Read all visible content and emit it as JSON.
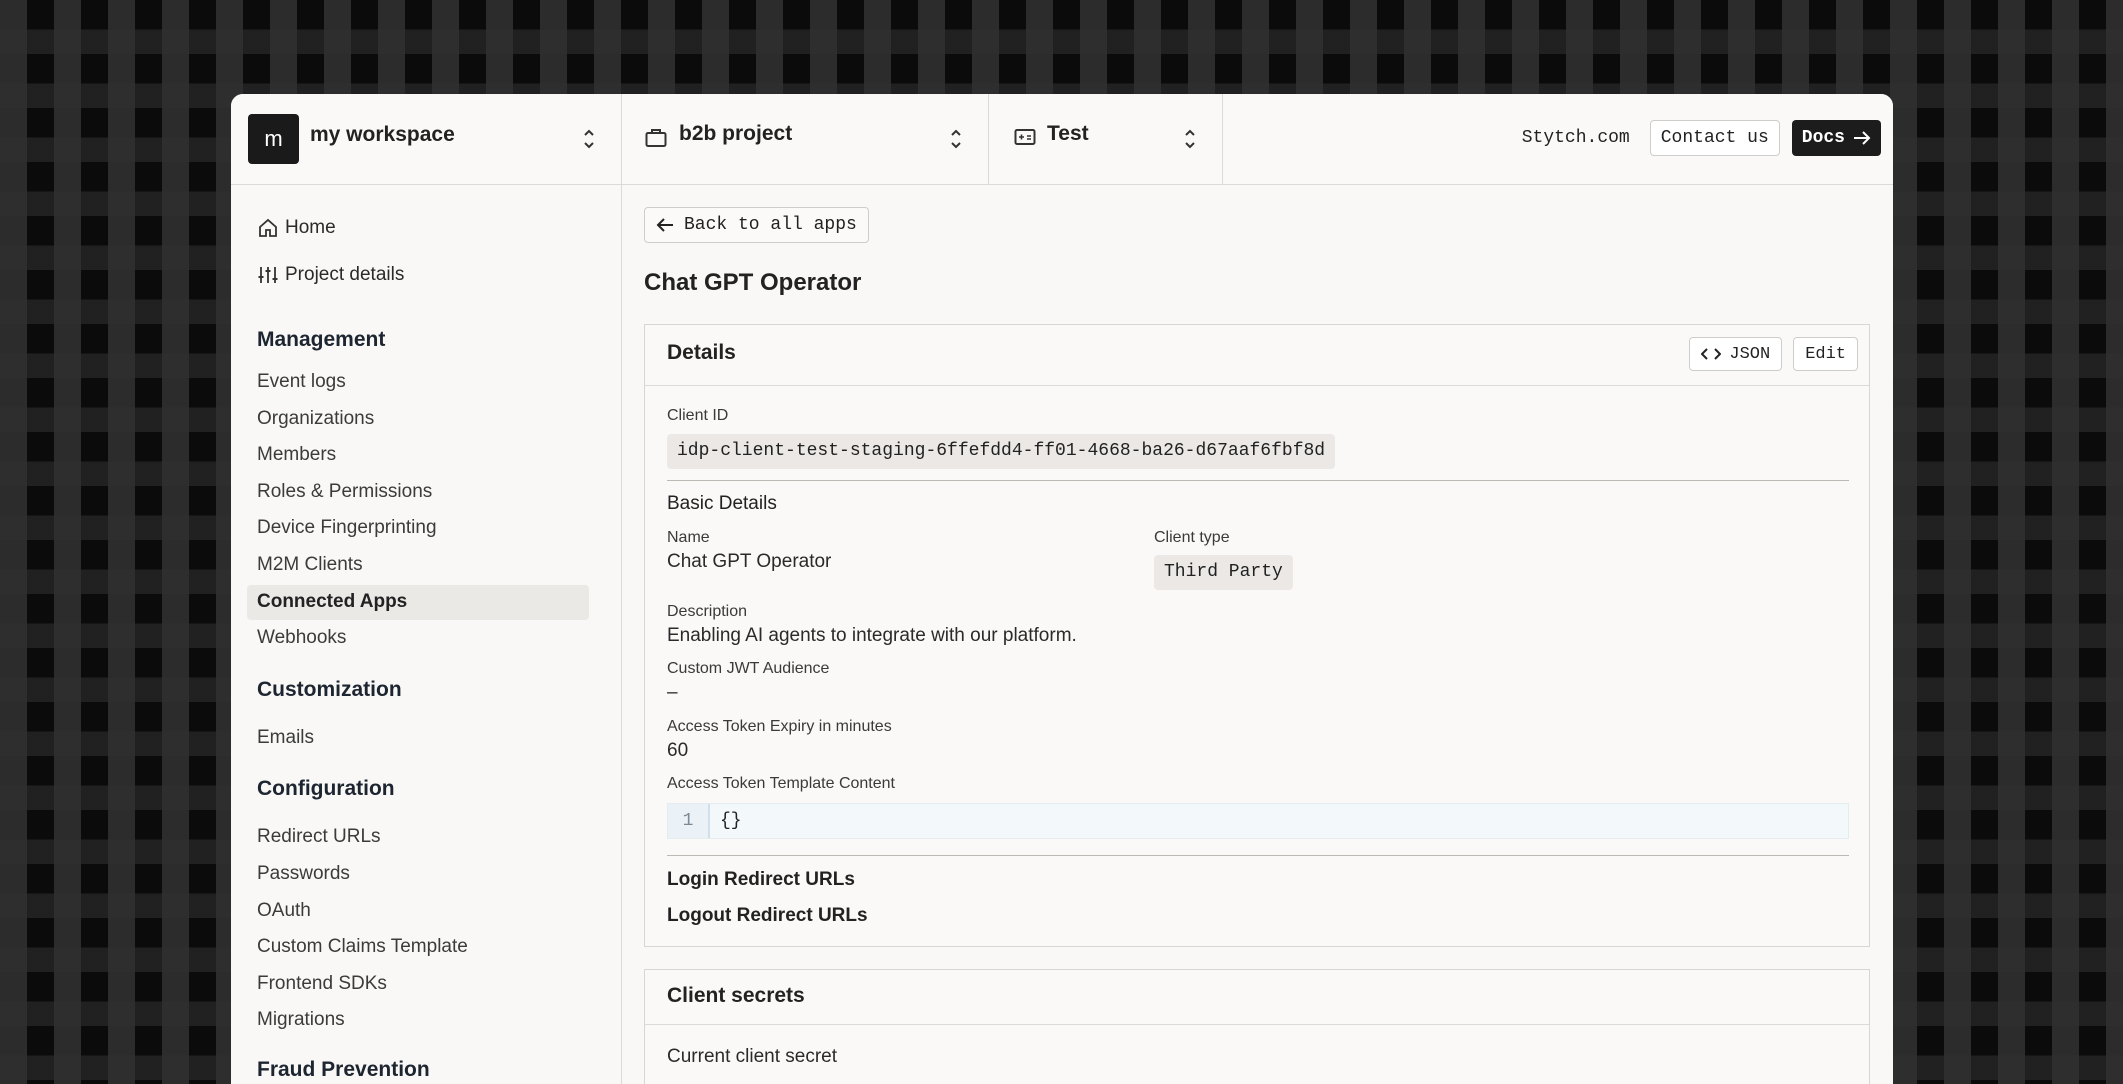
{
  "workspace": {
    "avatar_letter": "m",
    "name": "my workspace"
  },
  "project": {
    "name": "b2b project"
  },
  "environment": {
    "name": "Test"
  },
  "header_links": {
    "site": "Stytch.com",
    "contact": "Contact us",
    "docs": "Docs"
  },
  "sidebar": {
    "top": [
      {
        "label": "Home",
        "icon": "home-icon"
      },
      {
        "label": "Project details",
        "icon": "sliders-icon"
      }
    ],
    "sections": [
      {
        "title": "Management",
        "items": [
          "Event logs",
          "Organizations",
          "Members",
          "Roles & Permissions",
          "Device Fingerprinting",
          "M2M Clients",
          "Connected Apps",
          "Webhooks"
        ],
        "active": "Connected Apps"
      },
      {
        "title": "Customization",
        "items": [
          "Emails"
        ]
      },
      {
        "title": "Configuration",
        "items": [
          "Redirect URLs",
          "Passwords",
          "OAuth",
          "Custom Claims Template",
          "Frontend SDKs",
          "Migrations"
        ]
      },
      {
        "title": "Fraud Prevention",
        "items": []
      }
    ]
  },
  "main": {
    "back_label": "Back to all apps",
    "title": "Chat GPT Operator",
    "details": {
      "title": "Details",
      "json_label": "JSON",
      "edit_label": "Edit",
      "client_id_label": "Client ID",
      "client_id": "idp-client-test-staging-6ffefdd4-ff01-4668-ba26-d67aaf6fbf8d",
      "basic_details": "Basic Details",
      "name_label": "Name",
      "name": "Chat GPT Operator",
      "client_type_label": "Client type",
      "client_type": "Third Party",
      "description_label": "Description",
      "description": "Enabling AI agents to integrate with our platform.",
      "jwt_label": "Custom JWT Audience",
      "jwt_value": "–",
      "expiry_label": "Access Token Expiry in minutes",
      "expiry_value": "60",
      "template_label": "Access Token Template Content",
      "template_line_no": "1",
      "template_code": "{}",
      "login_redirects": "Login Redirect URLs",
      "logout_redirects": "Logout Redirect URLs"
    },
    "secrets": {
      "title": "Client secrets",
      "current_label": "Current client secret"
    }
  },
  "colors": {
    "accent_dark": "#1c1c1c",
    "panel_bg": "#f9f8f7",
    "active_bg": "#ebe9e6"
  }
}
